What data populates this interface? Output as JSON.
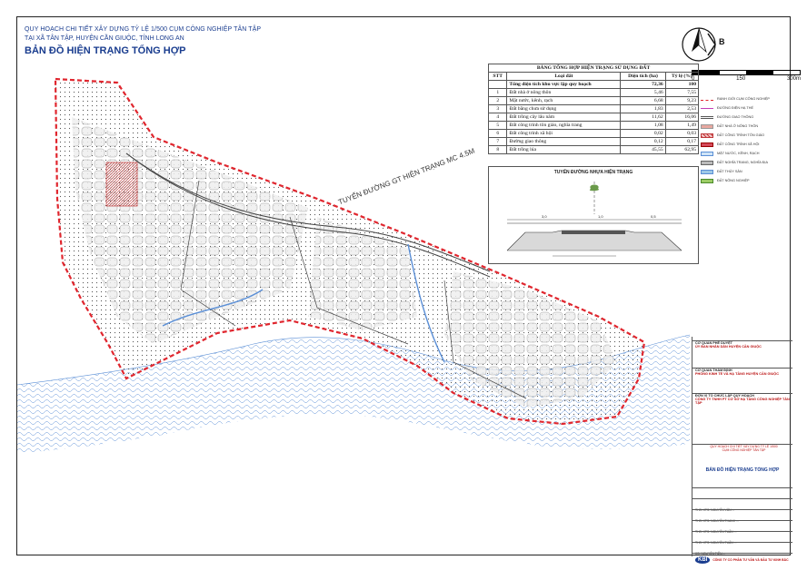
{
  "header": {
    "line1": "QUY HOẠCH CHI TIẾT XÂY DỰNG TỶ LỆ 1/500 CỤM CÔNG NGHIỆP TÂN TẬP",
    "line2": "TẠI XÃ TÂN TẬP, HUYỆN CẦN GIUỘC, TỈNH LONG AN",
    "title": "BẢN ĐỒ HIỆN TRẠNG TỔNG HỢP"
  },
  "north": {
    "letter": "B"
  },
  "scale": {
    "labels": [
      "0",
      "150",
      "300m"
    ]
  },
  "landuse_table": {
    "title": "BẢNG TỔNG HỢP HIỆN TRẠNG SỬ DỤNG ĐẤT",
    "headers": [
      "STT",
      "Loại đất",
      "Diện tích (ha)",
      "Tỷ lệ (%)"
    ],
    "total": {
      "label": "Tổng diện tích khu vực lập quy hoạch",
      "area": "72,36",
      "ratio": "100"
    },
    "rows": [
      {
        "stt": "1",
        "name": "Đất nhà ở nông thôn",
        "area": "5,46",
        "ratio": "7,55"
      },
      {
        "stt": "2",
        "name": "Mặt nước, kênh, rạch",
        "area": "6,68",
        "ratio": "9,23"
      },
      {
        "stt": "3",
        "name": "Đất bằng chưa sử dụng",
        "area": "1,83",
        "ratio": "2,53"
      },
      {
        "stt": "4",
        "name": "Đất trồng cây lâu năm",
        "area": "11,62",
        "ratio": "16,06"
      },
      {
        "stt": "5",
        "name": "Đất công trình tôn giáo, nghĩa trang",
        "area": "1,08",
        "ratio": "1,49"
      },
      {
        "stt": "6",
        "name": "Đất công trình xã hội",
        "area": "0,02",
        "ratio": "0,03"
      },
      {
        "stt": "7",
        "name": "Đường giao thông",
        "area": "0,12",
        "ratio": "0,17"
      },
      {
        "stt": "8",
        "name": "Đất trồng lúa",
        "area": "45,55",
        "ratio": "62,95"
      }
    ]
  },
  "section": {
    "title": "TUYẾN ĐƯỜNG NHỰA HIỆN TRẠNG",
    "dims": [
      "3,0",
      "1,0",
      "0,5"
    ]
  },
  "map_labels": {
    "road": "TUYẾN ĐƯỜNG GT HIỆN TRẠNG MC 4.5M"
  },
  "legend": [
    {
      "label": "RANH GIỚI CỤM CÔNG NGHIỆP",
      "color": "#e0262e"
    },
    {
      "label": "ĐƯỜNG ĐIỆN HẠ THẾ",
      "color": "#c23fb8"
    },
    {
      "label": "ĐƯỜNG GIAO THÔNG",
      "color": "#555555"
    },
    {
      "label": "ĐẤT NHÀ Ở NÔNG THÔN",
      "color": "#e8a8a0"
    },
    {
      "label": "ĐẤT CÔNG TRÌNH TÔN GIÁO",
      "color": "#c0393b"
    },
    {
      "label": "ĐẤT CÔNG TRÌNH XÃ HỘI",
      "color": "#d44a5a"
    },
    {
      "label": "MẶT NƯỚC, KÊNH, RẠCH",
      "color": "#cfe4f7"
    },
    {
      "label": "ĐẤT NGHĨA TRANG, NGHĨA ĐỊA",
      "color": "#bbbbbb"
    },
    {
      "label": "ĐẤT THỦY SẢN",
      "color": "#9ec8e6"
    },
    {
      "label": "ĐẤT NÔNG NGHIỆP",
      "color": "#9ccc65"
    }
  ],
  "title_block": {
    "approve_label": "CƠ QUAN PHÊ DUYỆT",
    "approve_value": "ỦY BAN NHÂN DÂN HUYỆN CẦN GIUỘC",
    "review_label": "CƠ QUAN THẨM ĐỊNH",
    "review_value": "PHÒNG KINH TẾ VÀ HẠ TẦNG HUYỆN CẦN GIUỘC",
    "org_label": "ĐƠN VỊ TỔ CHỨC LẬP QUY HOẠCH",
    "org_value": "CÔNG TY TNHH PT CƠ SỞ HẠ TẦNG CÔNG NGHIỆP TÂN TẬP",
    "drawing_title": "BẢN ĐỒ HIỆN TRẠNG TỔNG HỢP",
    "project_line1": "QUY HOẠCH CHI TIẾT XÂY DỰNG TỶ LỆ 1/500",
    "project_line2": "CỤM CÔNG NGHIỆP TÂN TẬP",
    "staff": [
      "THS. KTS. NGUYỄN VĂN ...",
      "THS. KTS. NGUYỄN THANH ...",
      "THS. KTS. NGUYỄN TUẤN ...",
      "THS. KTS. NGUYỄN TUẤN ...",
      "KS. NGUYỄN TIẾN ..."
    ],
    "company_logo": "KBI",
    "company_name": "CÔNG TY CỔ PHẦN TƯ VẤN VÀ ĐẦU TƯ KINH BẮC"
  },
  "colors": {
    "boundary": "#e0262e",
    "water": "#5b8fd6",
    "header": "#1a3d8f",
    "rice": "#ffffff",
    "trees": "#e9e9e9"
  }
}
